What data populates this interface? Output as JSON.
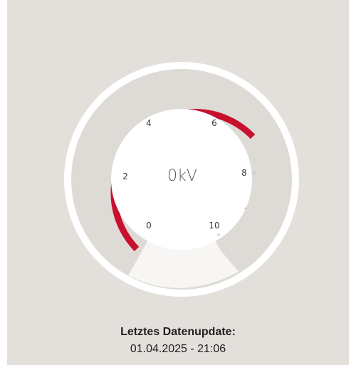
{
  "gauge": {
    "value_display": "0kV",
    "value": 0,
    "min": 0,
    "max": 10,
    "tick_labels": [
      "0",
      "2",
      "4",
      "6",
      "8",
      "10"
    ],
    "accent_color": "#c8102e",
    "track_color": "#dedad6",
    "ring_color": "#ffffff",
    "background_color": "#e3e0dc"
  },
  "update": {
    "title": "Letztes Datenupdate:",
    "timestamp": "01.04.2025 - 21:06"
  }
}
